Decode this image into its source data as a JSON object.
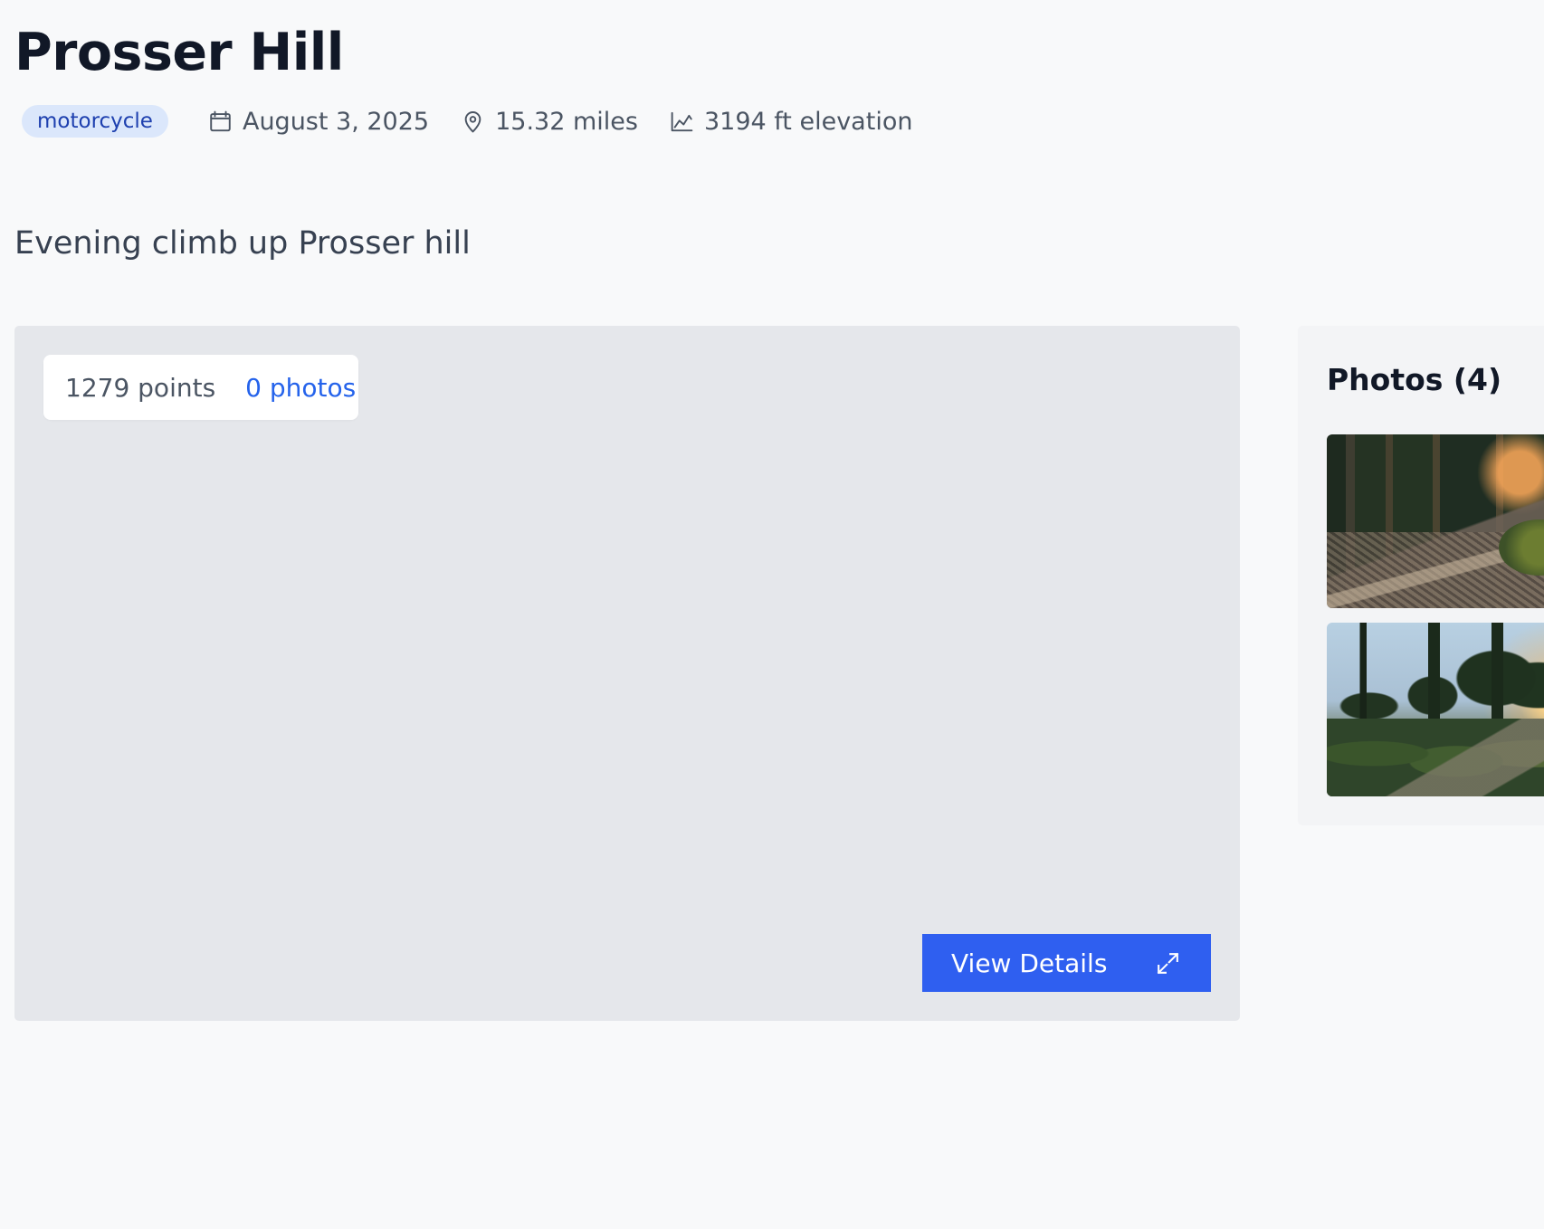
{
  "trip": {
    "title": "Prosser Hill",
    "category": "motorcycle",
    "date": "August 3, 2025",
    "distance": "15.32 miles",
    "elevation": "3194 ft elevation",
    "description": "Evening climb up Prosser hill"
  },
  "map": {
    "points": "1279 points",
    "photos_link": "0 photos",
    "view_details_label": "View Details",
    "expand_icon": "expand-icon"
  },
  "photos": {
    "title": "Photos (4)",
    "items": [
      {
        "icon": "forest-trail-photo"
      },
      {
        "icon": "forest-sunset-photo"
      }
    ]
  },
  "icons": {
    "calendar": "calendar-icon",
    "location": "map-pin-icon",
    "elevation": "chart-line-icon"
  },
  "colors": {
    "background": "#f8f9fa",
    "map_panel": "#e5e7eb",
    "primary_button": "#2f5ff0",
    "tag_background": "#dbe7fb",
    "tag_text": "#1e40af",
    "link": "#2563eb"
  }
}
